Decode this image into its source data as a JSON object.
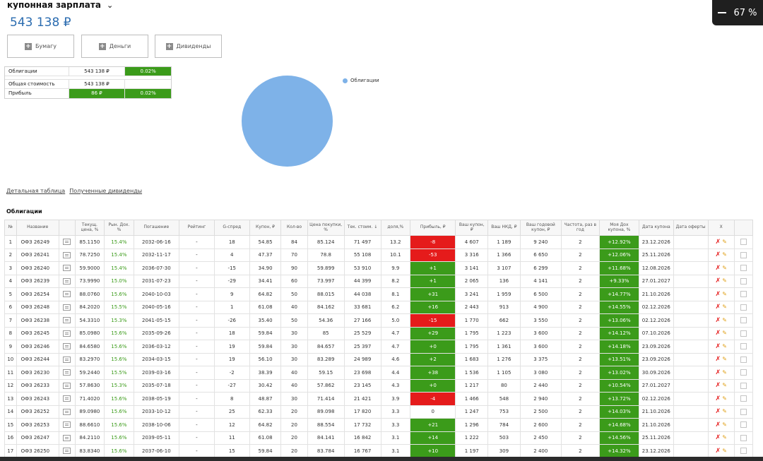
{
  "header": {
    "title": "купонная зарплата",
    "chevron": "chevron-down-icon",
    "total": "543 138 ₽"
  },
  "zoom": {
    "value": "67 %"
  },
  "actions": [
    {
      "label": "Бумагу",
      "icon": "plus-icon"
    },
    {
      "label": "Деньги",
      "icon": "plus-icon"
    },
    {
      "label": "Дивиденды",
      "icon": "plus-icon"
    }
  ],
  "summary": {
    "bonds_label": "Облигации",
    "bonds_value": "543 138 ₽",
    "bonds_pct": "0.02%",
    "total_label": "Общая стоимость",
    "total_value": "543 138 ₽",
    "profit_label": "Прибыль",
    "profit_value": "86 ₽",
    "profit_pct": "0.02%"
  },
  "chart_data": {
    "type": "pie",
    "categories": [
      "Облигации"
    ],
    "values": [
      100
    ],
    "legend": "top-right",
    "colors": [
      "#7eb2e8"
    ]
  },
  "links": [
    "Детальная таблица",
    "Полученные дивиденды"
  ],
  "section_title": "Облигации",
  "columns": [
    "№",
    "Название",
    "",
    "Текущ. цена, %",
    "Рын. Дох. %",
    "Погашение",
    "Рейтинг",
    "G-спред",
    "Купон, ₽",
    "Кол-во",
    "Цена покупки, %",
    "Тек. стоим. ↓",
    "доля,%",
    "Прибыль, ₽",
    "Ваш купон, ₽",
    "Ваш НКД, ₽",
    "Ваш годовой купон, ₽",
    "Частота, раз в год",
    "Моя Дох купона, %",
    "Дата купона",
    "Дата оферты",
    "X",
    ""
  ],
  "rows": [
    {
      "n": "1",
      "name": "ОФЗ 26249",
      "price": "85.1150",
      "yld": "15.4%",
      "maturity": "2032-06-16",
      "rating": "-",
      "spread": "18",
      "coupon": "54.85",
      "qty": "84",
      "buy": "85.124",
      "value": "71 497",
      "share": "13.2",
      "profit": "-8",
      "pt": "neg",
      "cpn": "4 607",
      "nkd": "1 189",
      "annual": "9 240",
      "freq": "2",
      "ret": "+12.92%",
      "date": "23.12.2026"
    },
    {
      "n": "2",
      "name": "ОФЗ 26241",
      "price": "78.7250",
      "yld": "15.4%",
      "maturity": "2032-11-17",
      "rating": "-",
      "spread": "4",
      "coupon": "47.37",
      "qty": "70",
      "buy": "78.8",
      "value": "55 108",
      "share": "10.1",
      "profit": "-53",
      "pt": "neg",
      "cpn": "3 316",
      "nkd": "1 366",
      "annual": "6 650",
      "freq": "2",
      "ret": "+12.06%",
      "date": "25.11.2026"
    },
    {
      "n": "3",
      "name": "ОФЗ 26240",
      "price": "59.9000",
      "yld": "15.4%",
      "maturity": "2036-07-30",
      "rating": "-",
      "spread": "-15",
      "coupon": "34.90",
      "qty": "90",
      "buy": "59.899",
      "value": "53 910",
      "share": "9.9",
      "profit": "+1",
      "pt": "pos",
      "cpn": "3 141",
      "nkd": "3 107",
      "annual": "6 299",
      "freq": "2",
      "ret": "+11.68%",
      "date": "12.08.2026"
    },
    {
      "n": "4",
      "name": "ОФЗ 26239",
      "price": "73.9990",
      "yld": "15.0%",
      "maturity": "2031-07-23",
      "rating": "-",
      "spread": "-29",
      "coupon": "34.41",
      "qty": "60",
      "buy": "73.997",
      "value": "44 399",
      "share": "8.2",
      "profit": "+1",
      "pt": "pos",
      "cpn": "2 065",
      "nkd": "136",
      "annual": "4 141",
      "freq": "2",
      "ret": "+9.33%",
      "date": "27.01.2027"
    },
    {
      "n": "5",
      "name": "ОФЗ 26254",
      "price": "88.0760",
      "yld": "15.6%",
      "maturity": "2040-10-03",
      "rating": "-",
      "spread": "9",
      "coupon": "64.82",
      "qty": "50",
      "buy": "88.015",
      "value": "44 038",
      "share": "8.1",
      "profit": "+31",
      "pt": "pos",
      "cpn": "3 241",
      "nkd": "1 959",
      "annual": "6 500",
      "freq": "2",
      "ret": "+14.77%",
      "date": "21.10.2026"
    },
    {
      "n": "6",
      "name": "ОФЗ 26248",
      "price": "84.2020",
      "yld": "15.5%",
      "maturity": "2040-05-16",
      "rating": "-",
      "spread": "1",
      "coupon": "61.08",
      "qty": "40",
      "buy": "84.162",
      "value": "33 681",
      "share": "6.2",
      "profit": "+16",
      "pt": "pos",
      "cpn": "2 443",
      "nkd": "913",
      "annual": "4 900",
      "freq": "2",
      "ret": "+14.55%",
      "date": "02.12.2026"
    },
    {
      "n": "7",
      "name": "ОФЗ 26238",
      "price": "54.3310",
      "yld": "15.3%",
      "maturity": "2041-05-15",
      "rating": "-",
      "spread": "-26",
      "coupon": "35.40",
      "qty": "50",
      "buy": "54.36",
      "value": "27 166",
      "share": "5.0",
      "profit": "-15",
      "pt": "neg",
      "cpn": "1 770",
      "nkd": "662",
      "annual": "3 550",
      "freq": "2",
      "ret": "+13.06%",
      "date": "02.12.2026"
    },
    {
      "n": "8",
      "name": "ОФЗ 26245",
      "price": "85.0980",
      "yld": "15.6%",
      "maturity": "2035-09-26",
      "rating": "-",
      "spread": "18",
      "coupon": "59.84",
      "qty": "30",
      "buy": "85",
      "value": "25 529",
      "share": "4.7",
      "profit": "+29",
      "pt": "pos",
      "cpn": "1 795",
      "nkd": "1 223",
      "annual": "3 600",
      "freq": "2",
      "ret": "+14.12%",
      "date": "07.10.2026"
    },
    {
      "n": "9",
      "name": "ОФЗ 26246",
      "price": "84.6580",
      "yld": "15.6%",
      "maturity": "2036-03-12",
      "rating": "-",
      "spread": "19",
      "coupon": "59.84",
      "qty": "30",
      "buy": "84.657",
      "value": "25 397",
      "share": "4.7",
      "profit": "+0",
      "pt": "pos",
      "cpn": "1 795",
      "nkd": "1 361",
      "annual": "3 600",
      "freq": "2",
      "ret": "+14.18%",
      "date": "23.09.2026"
    },
    {
      "n": "10",
      "name": "ОФЗ 26244",
      "price": "83.2970",
      "yld": "15.6%",
      "maturity": "2034-03-15",
      "rating": "-",
      "spread": "19",
      "coupon": "56.10",
      "qty": "30",
      "buy": "83.289",
      "value": "24 989",
      "share": "4.6",
      "profit": "+2",
      "pt": "pos",
      "cpn": "1 683",
      "nkd": "1 276",
      "annual": "3 375",
      "freq": "2",
      "ret": "+13.51%",
      "date": "23.09.2026"
    },
    {
      "n": "11",
      "name": "ОФЗ 26230",
      "price": "59.2440",
      "yld": "15.5%",
      "maturity": "2039-03-16",
      "rating": "-",
      "spread": "-2",
      "coupon": "38.39",
      "qty": "40",
      "buy": "59.15",
      "value": "23 698",
      "share": "4.4",
      "profit": "+38",
      "pt": "pos",
      "cpn": "1 536",
      "nkd": "1 105",
      "annual": "3 080",
      "freq": "2",
      "ret": "+13.02%",
      "date": "30.09.2026"
    },
    {
      "n": "12",
      "name": "ОФЗ 26233",
      "price": "57.8630",
      "yld": "15.3%",
      "maturity": "2035-07-18",
      "rating": "-",
      "spread": "-27",
      "coupon": "30.42",
      "qty": "40",
      "buy": "57.862",
      "value": "23 145",
      "share": "4.3",
      "profit": "+0",
      "pt": "pos",
      "cpn": "1 217",
      "nkd": "80",
      "annual": "2 440",
      "freq": "2",
      "ret": "+10.54%",
      "date": "27.01.2027"
    },
    {
      "n": "13",
      "name": "ОФЗ 26243",
      "price": "71.4020",
      "yld": "15.6%",
      "maturity": "2038-05-19",
      "rating": "-",
      "spread": "8",
      "coupon": "48.87",
      "qty": "30",
      "buy": "71.414",
      "value": "21 421",
      "share": "3.9",
      "profit": "-4",
      "pt": "neg",
      "cpn": "1 466",
      "nkd": "548",
      "annual": "2 940",
      "freq": "2",
      "ret": "+13.72%",
      "date": "02.12.2026"
    },
    {
      "n": "14",
      "name": "ОФЗ 26252",
      "price": "89.0980",
      "yld": "15.6%",
      "maturity": "2033-10-12",
      "rating": "-",
      "spread": "25",
      "coupon": "62.33",
      "qty": "20",
      "buy": "89.098",
      "value": "17 820",
      "share": "3.3",
      "profit": "0",
      "pt": "zero",
      "cpn": "1 247",
      "nkd": "753",
      "annual": "2 500",
      "freq": "2",
      "ret": "+14.03%",
      "date": "21.10.2026"
    },
    {
      "n": "15",
      "name": "ОФЗ 26253",
      "price": "88.6610",
      "yld": "15.6%",
      "maturity": "2038-10-06",
      "rating": "-",
      "spread": "12",
      "coupon": "64.82",
      "qty": "20",
      "buy": "88.554",
      "value": "17 732",
      "share": "3.3",
      "profit": "+21",
      "pt": "pos",
      "cpn": "1 296",
      "nkd": "784",
      "annual": "2 600",
      "freq": "2",
      "ret": "+14.68%",
      "date": "21.10.2026"
    },
    {
      "n": "16",
      "name": "ОФЗ 26247",
      "price": "84.2110",
      "yld": "15.6%",
      "maturity": "2039-05-11",
      "rating": "-",
      "spread": "11",
      "coupon": "61.08",
      "qty": "20",
      "buy": "84.141",
      "value": "16 842",
      "share": "3.1",
      "profit": "+14",
      "pt": "pos",
      "cpn": "1 222",
      "nkd": "503",
      "annual": "2 450",
      "freq": "2",
      "ret": "+14.56%",
      "date": "25.11.2026"
    },
    {
      "n": "17",
      "name": "ОФЗ 26250",
      "price": "83.8340",
      "yld": "15.6%",
      "maturity": "2037-06-10",
      "rating": "-",
      "spread": "15",
      "coupon": "59.84",
      "qty": "20",
      "buy": "83.784",
      "value": "16 767",
      "share": "3.1",
      "profit": "+10",
      "pt": "pos",
      "cpn": "1 197",
      "nkd": "309",
      "annual": "2 400",
      "freq": "2",
      "ret": "+14.32%",
      "date": "23.12.2026"
    }
  ]
}
